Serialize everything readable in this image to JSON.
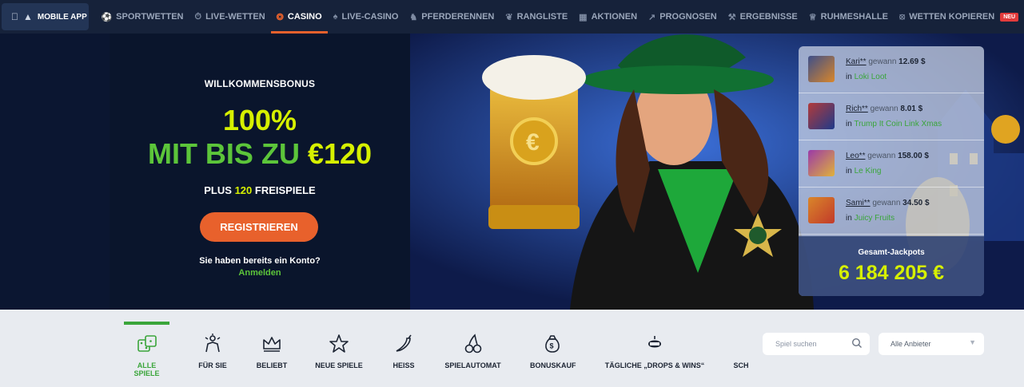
{
  "topnav": {
    "mobile_app": "MOBILE APP",
    "items": [
      {
        "label": "SPORTWETTEN",
        "icon": "soccer-ball-icon"
      },
      {
        "label": "LIVE-WETTEN",
        "icon": "stopwatch-icon"
      },
      {
        "label": "CASINO",
        "icon": "roulette-icon",
        "active": true
      },
      {
        "label": "LIVE-CASINO",
        "icon": "cards-icon"
      },
      {
        "label": "PFERDERENNEN",
        "icon": "horse-icon"
      },
      {
        "label": "RANGLISTE",
        "icon": "laurel-icon"
      },
      {
        "label": "AKTIONEN",
        "icon": "gift-icon"
      },
      {
        "label": "PROGNOSEN",
        "icon": "chart-icon"
      },
      {
        "label": "ERGEBNISSE",
        "icon": "hammers-icon"
      },
      {
        "label": "RUHMESHALLE",
        "icon": "trophy-icon"
      },
      {
        "label": "WETTEN KOPIEREN",
        "icon": "copy-icon",
        "badge": "NEU"
      }
    ]
  },
  "bonus": {
    "welcome": "WILLKOMMENSBONUS",
    "percent": "100%",
    "upto_prefix": "MIT BIS ZU ",
    "upto_amount": "€120",
    "spins_prefix": "PLUS ",
    "spins_number": "120",
    "spins_suffix": " FREISPIELE",
    "register": "REGISTRIEREN",
    "has_account": "Sie haben bereits ein Konto?",
    "login": "Anmelden"
  },
  "winners": [
    {
      "name": "Kari**",
      "verb": "gewann",
      "amount": "12.69 $",
      "in": "in",
      "game": "Loki Loot",
      "thumb_color": "#3d4f8a"
    },
    {
      "name": "Rich**",
      "verb": "gewann",
      "amount": "8.01 $",
      "in": "in",
      "game": "Trump It Coin Link Xmas",
      "thumb_color": "#b23a3a"
    },
    {
      "name": "Leo**",
      "verb": "gewann",
      "amount": "158.00 $",
      "in": "in",
      "game": "Le King",
      "thumb_color": "#9b3aa8"
    },
    {
      "name": "Sami**",
      "verb": "gewann",
      "amount": "34.50 $",
      "in": "in",
      "game": "Juicy Fruits",
      "thumb_color": "#d9862a"
    }
  ],
  "jackpot": {
    "label": "Gesamt-Jackpots",
    "value": "6 184 205 €"
  },
  "categories": [
    {
      "label": "ALLE SPIELE",
      "icon": "dice-icon",
      "active": true
    },
    {
      "label": "FÜR SIE",
      "icon": "spark-hand-icon"
    },
    {
      "label": "BELIEBT",
      "icon": "crown-icon"
    },
    {
      "label": "NEUE SPIELE",
      "icon": "star-icon"
    },
    {
      "label": "HEISS",
      "icon": "chili-icon"
    },
    {
      "label": "SPIELAUTOMAT",
      "icon": "cherry-icon"
    },
    {
      "label": "BONUSKAUF",
      "icon": "money-bag-icon"
    },
    {
      "label": "TÄGLICHE „DROPS & WINS“",
      "icon": "drops-wins-icon"
    },
    {
      "label": "SCH",
      "icon": ""
    }
  ],
  "search": {
    "placeholder": "Spiel suchen"
  },
  "provider": {
    "label": "Alle Anbieter"
  },
  "colors": {
    "accent": "#e8612c",
    "green": "#5cc53a",
    "lime": "#d6f000",
    "nav_bg": "#16223a"
  }
}
